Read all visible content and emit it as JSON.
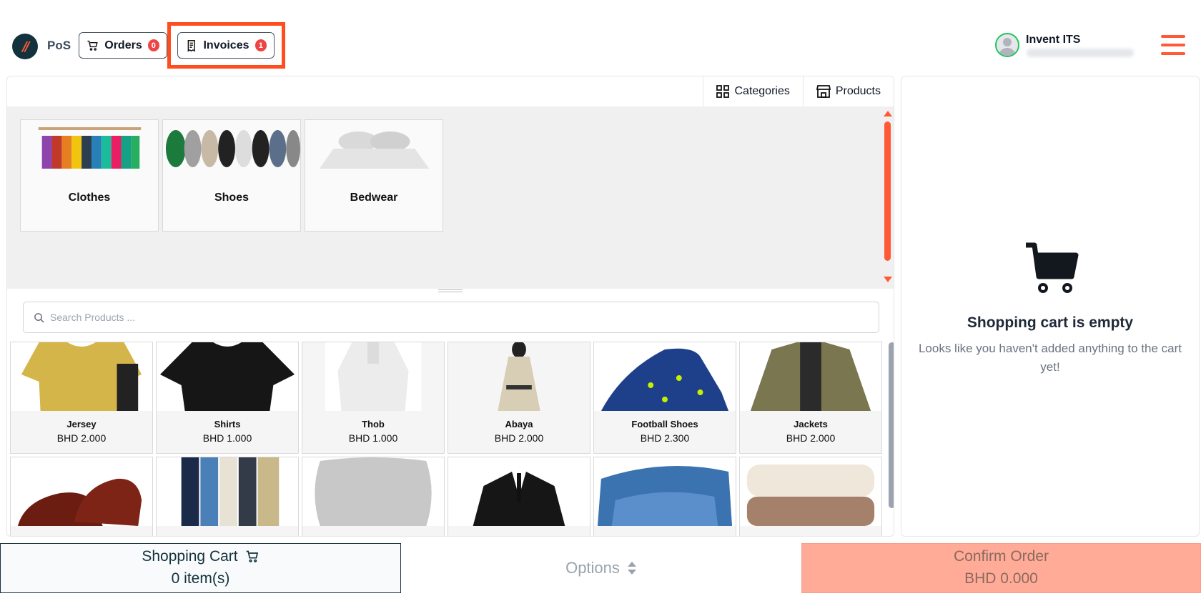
{
  "header": {
    "app_name": "PoS",
    "orders_label": "Orders",
    "orders_count": "0",
    "invoices_label": "Invoices",
    "invoices_count": "1",
    "user_name": "Invent ITS"
  },
  "tabs": {
    "categories": "Categories",
    "products": "Products"
  },
  "categories": [
    {
      "label": "Clothes"
    },
    {
      "label": "Shoes"
    },
    {
      "label": "Bedwear"
    }
  ],
  "search": {
    "placeholder": "Search Products ..."
  },
  "products": [
    {
      "name": "Jersey",
      "price": "BHD 2.000"
    },
    {
      "name": "Shirts",
      "price": "BHD 1.000"
    },
    {
      "name": "Thob",
      "price": "BHD 1.000"
    },
    {
      "name": "Abaya",
      "price": "BHD 2.000"
    },
    {
      "name": "Football Shoes",
      "price": "BHD 2.300"
    },
    {
      "name": "Jackets",
      "price": "BHD 2.000"
    }
  ],
  "cart": {
    "empty_title": "Shopping cart is empty",
    "empty_message": "Looks like you haven't added anything to the cart yet!"
  },
  "bottom": {
    "cart_label": "Shopping Cart",
    "cart_items": "0 item(s)",
    "options_label": "Options",
    "confirm_label": "Confirm Order",
    "confirm_total": "BHD 0.000"
  },
  "colors": {
    "accent": "#ff5a36",
    "dark": "#13323d",
    "badge": "#ef4444"
  }
}
